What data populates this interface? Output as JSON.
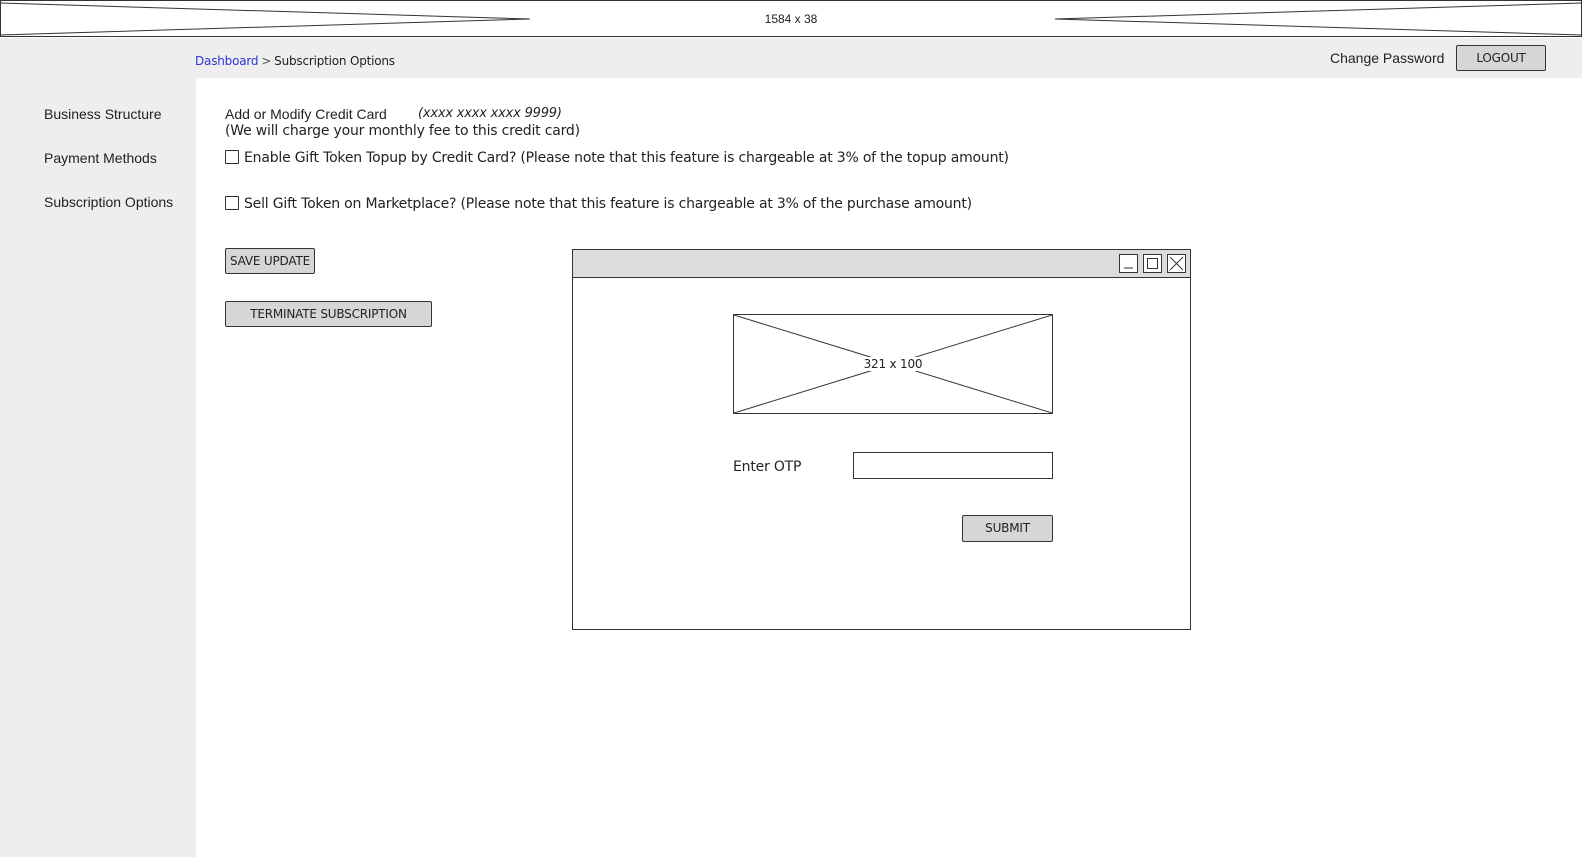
{
  "banner": {
    "label": "1584 x 38"
  },
  "breadcrumb": {
    "home": "Dashboard",
    "separator": ">",
    "current": "Subscription Options"
  },
  "header": {
    "change_password": "Change Password",
    "logout": "LOGOUT"
  },
  "sidebar": {
    "items": [
      {
        "label": "Business Structure"
      },
      {
        "label": "Payment Methods"
      },
      {
        "label": "Subscription Options"
      }
    ]
  },
  "main": {
    "credit_card_label": "Add or Modify Credit Card",
    "credit_card_masked": "(xxxx xxxx xxxx 9999)",
    "credit_card_note": "(We will charge your monthly fee to this credit card)",
    "option_topup": {
      "label": "Enable Gift Token Topup by Credit Card? (Please note that this feature is chargeable at 3% of the topup amount)",
      "checked": false
    },
    "option_marketplace": {
      "label": "Sell Gift Token on Marketplace? (Please note that this feature is chargeable at 3% of the purchase amount)",
      "checked": false
    },
    "save_button": "SAVE UPDATE",
    "terminate_button": "TERMINATE SUBSCRIPTION"
  },
  "modal": {
    "image_label": "321 x 100",
    "otp_label": "Enter OTP",
    "otp_value": "",
    "submit_button": "SUBMIT"
  }
}
